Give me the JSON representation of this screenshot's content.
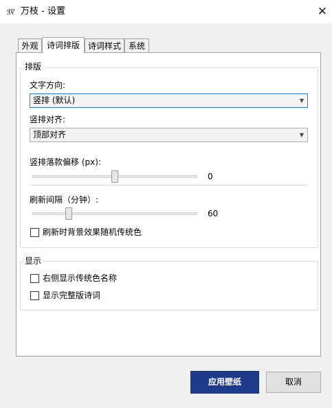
{
  "window": {
    "title": "万枝 - 设置",
    "app_icon_glyph": "𝔐"
  },
  "tabs": [
    {
      "label": "外观",
      "active": false
    },
    {
      "label": "诗词排版",
      "active": true
    },
    {
      "label": "诗词样式",
      "active": false
    },
    {
      "label": "系统",
      "active": false
    }
  ],
  "layout_group": {
    "title": "排版",
    "text_direction": {
      "label": "文字方向:",
      "value": "竖排 (默认)"
    },
    "vertical_align": {
      "label": "竖排对齐:",
      "value": "顶部对齐"
    },
    "offset": {
      "label": "竖排落款偏移 (px):",
      "value": 0,
      "fraction": 0.5
    },
    "refresh": {
      "label": "刷新间隔（分钟）:",
      "value": 60,
      "fraction": 0.22
    },
    "random_color": {
      "label": "刷新时背景效果随机传统色",
      "checked": false
    }
  },
  "display_group": {
    "title": "显示",
    "show_color_name": {
      "label": "右侧显示传统色名称",
      "checked": false
    },
    "show_full_poem": {
      "label": "显示完整版诗词",
      "checked": false
    }
  },
  "buttons": {
    "apply": "应用壁纸",
    "cancel": "取消"
  },
  "colors": {
    "primary": "#1e3a8a",
    "focus_border": "#2b7bd6"
  }
}
